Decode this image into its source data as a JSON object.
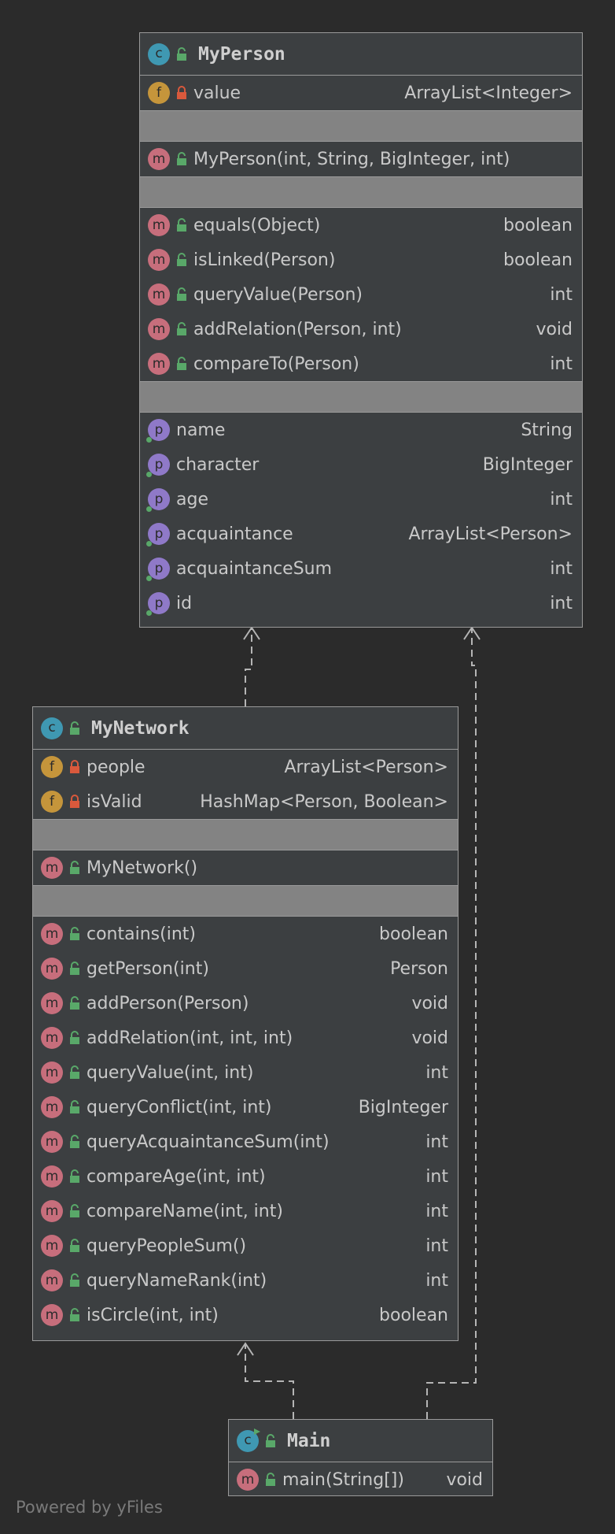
{
  "classes": {
    "my_person": {
      "name": "MyPerson",
      "fields": [
        {
          "name": "value",
          "type": "ArrayList<Integer>",
          "visibility": "private"
        }
      ],
      "constructors": [
        {
          "name": "MyPerson(int, String, BigInteger, int)",
          "type": "",
          "visibility": "public"
        }
      ],
      "methods": [
        {
          "name": "equals(Object)",
          "type": "boolean"
        },
        {
          "name": "isLinked(Person)",
          "type": "boolean"
        },
        {
          "name": "queryValue(Person)",
          "type": "int"
        },
        {
          "name": "addRelation(Person, int)",
          "type": "void"
        },
        {
          "name": "compareTo(Person)",
          "type": "int"
        }
      ],
      "properties": [
        {
          "name": "name",
          "type": "String"
        },
        {
          "name": "character",
          "type": "BigInteger"
        },
        {
          "name": "age",
          "type": "int"
        },
        {
          "name": "acquaintance",
          "type": "ArrayList<Person>"
        },
        {
          "name": "acquaintanceSum",
          "type": "int"
        },
        {
          "name": "id",
          "type": "int"
        }
      ]
    },
    "my_network": {
      "name": "MyNetwork",
      "fields": [
        {
          "name": "people",
          "type": "ArrayList<Person>",
          "visibility": "private"
        },
        {
          "name": "isValid",
          "type": "HashMap<Person, Boolean>",
          "visibility": "private"
        }
      ],
      "constructors": [
        {
          "name": "MyNetwork()",
          "type": "",
          "visibility": "public"
        }
      ],
      "methods": [
        {
          "name": "contains(int)",
          "type": "boolean"
        },
        {
          "name": "getPerson(int)",
          "type": "Person"
        },
        {
          "name": "addPerson(Person)",
          "type": "void"
        },
        {
          "name": "addRelation(int, int, int)",
          "type": "void"
        },
        {
          "name": "queryValue(int, int)",
          "type": "int"
        },
        {
          "name": "queryConflict(int, int)",
          "type": "BigInteger"
        },
        {
          "name": "queryAcquaintanceSum(int)",
          "type": "int"
        },
        {
          "name": "compareAge(int, int)",
          "type": "int"
        },
        {
          "name": "compareName(int, int)",
          "type": "int"
        },
        {
          "name": "queryPeopleSum()",
          "type": "int"
        },
        {
          "name": "queryNameRank(int)",
          "type": "int"
        },
        {
          "name": "isCircle(int, int)",
          "type": "boolean"
        }
      ]
    },
    "main": {
      "name": "Main",
      "methods": [
        {
          "name": "main(String[])",
          "type": "void"
        }
      ]
    }
  },
  "icons": {
    "class": "c",
    "method": "m",
    "field": "f",
    "property": "p"
  },
  "colors": {
    "background": "#2b2b2b",
    "box": "#3c3f41",
    "divider": "#838383",
    "method_icon": "#c76e7c",
    "field_icon": "#c5953b",
    "property_icon": "#8f79c8",
    "class_icon": "#3f98b2",
    "public_lock": "#59a869",
    "private_lock": "#d9593c"
  },
  "footer": "Powered by yFiles"
}
